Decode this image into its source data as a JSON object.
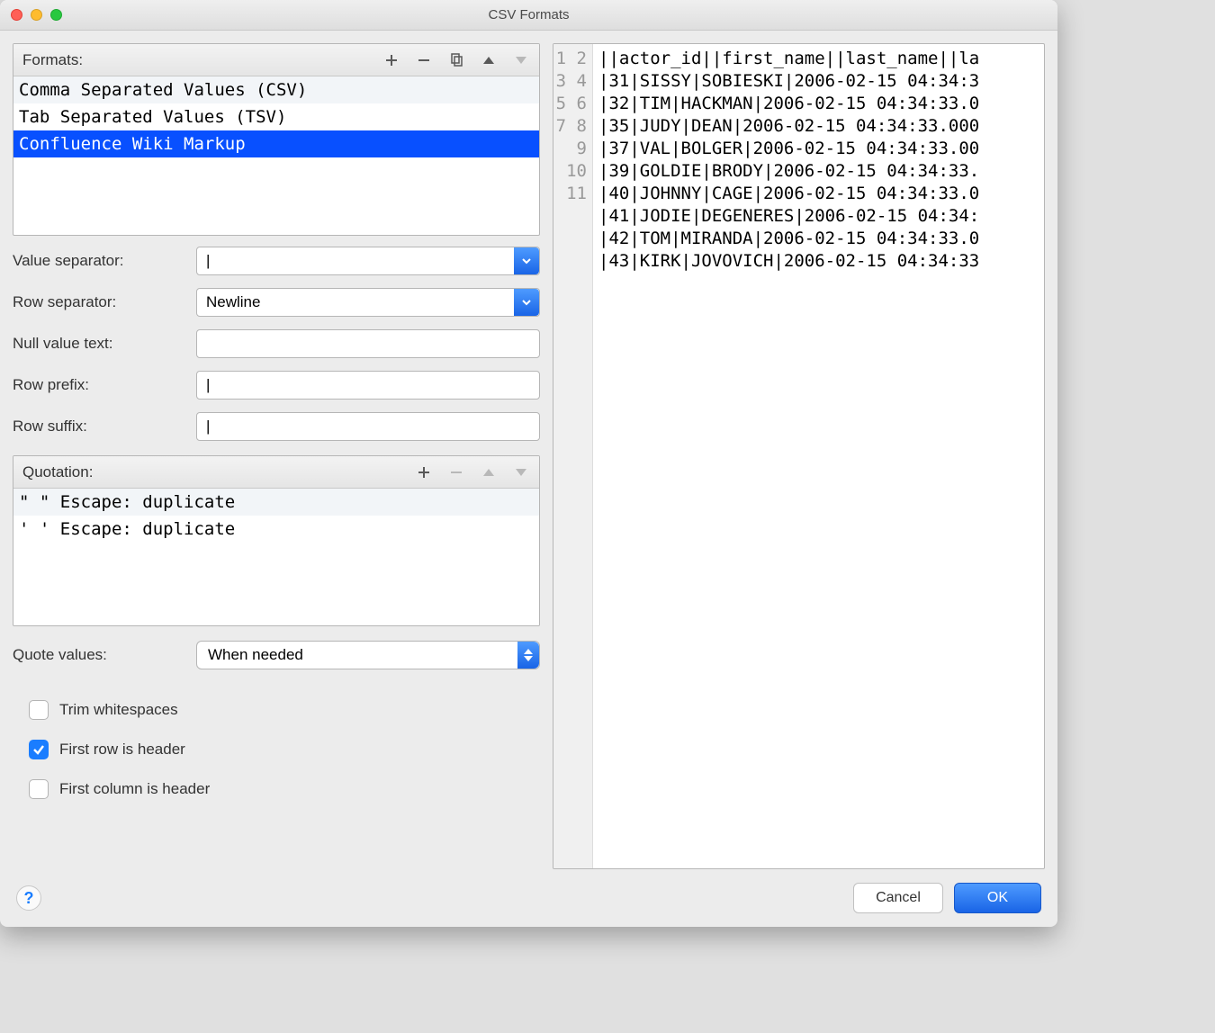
{
  "window": {
    "title": "CSV Formats"
  },
  "formats": {
    "label": "Formats:",
    "items": [
      "Comma Separated Values (CSV)",
      "Tab Separated Values (TSV)",
      "Confluence Wiki Markup"
    ],
    "selected_index": 2
  },
  "fields": {
    "value_separator": {
      "label": "Value separator:",
      "value": "|"
    },
    "row_separator": {
      "label": "Row separator:",
      "value": "Newline"
    },
    "null_value": {
      "label": "Null value text:",
      "value": ""
    },
    "row_prefix": {
      "label": "Row prefix:",
      "value": "|"
    },
    "row_suffix": {
      "label": "Row suffix:",
      "value": "|"
    }
  },
  "quotation": {
    "label": "Quotation:",
    "items": [
      "\"  \"  Escape: duplicate",
      "'  '  Escape: duplicate"
    ]
  },
  "quote_values": {
    "label": "Quote values:",
    "value": "When needed"
  },
  "checks": {
    "trim": {
      "label": "Trim whitespaces",
      "checked": false
    },
    "first_row": {
      "label": "First row is header",
      "checked": true
    },
    "first_col": {
      "label": "First column is header",
      "checked": false
    }
  },
  "preview": {
    "line_numbers": [
      "1",
      "2",
      "3",
      "4",
      "5",
      "6",
      "7",
      "8",
      "9",
      "10",
      "11"
    ],
    "lines": [
      "||actor_id||first_name||last_name||la",
      "|31|SISSY|SOBIESKI|2006-02-15 04:34:3",
      "|32|TIM|HACKMAN|2006-02-15 04:34:33.0",
      "|35|JUDY|DEAN|2006-02-15 04:34:33.000",
      "|37|VAL|BOLGER|2006-02-15 04:34:33.00",
      "|39|GOLDIE|BRODY|2006-02-15 04:34:33.",
      "|40|JOHNNY|CAGE|2006-02-15 04:34:33.0",
      "|41|JODIE|DEGENERES|2006-02-15 04:34:",
      "|42|TOM|MIRANDA|2006-02-15 04:34:33.0",
      "|43|KIRK|JOVOVICH|2006-02-15 04:34:33",
      ""
    ]
  },
  "buttons": {
    "cancel": "Cancel",
    "ok": "OK",
    "help": "?"
  }
}
